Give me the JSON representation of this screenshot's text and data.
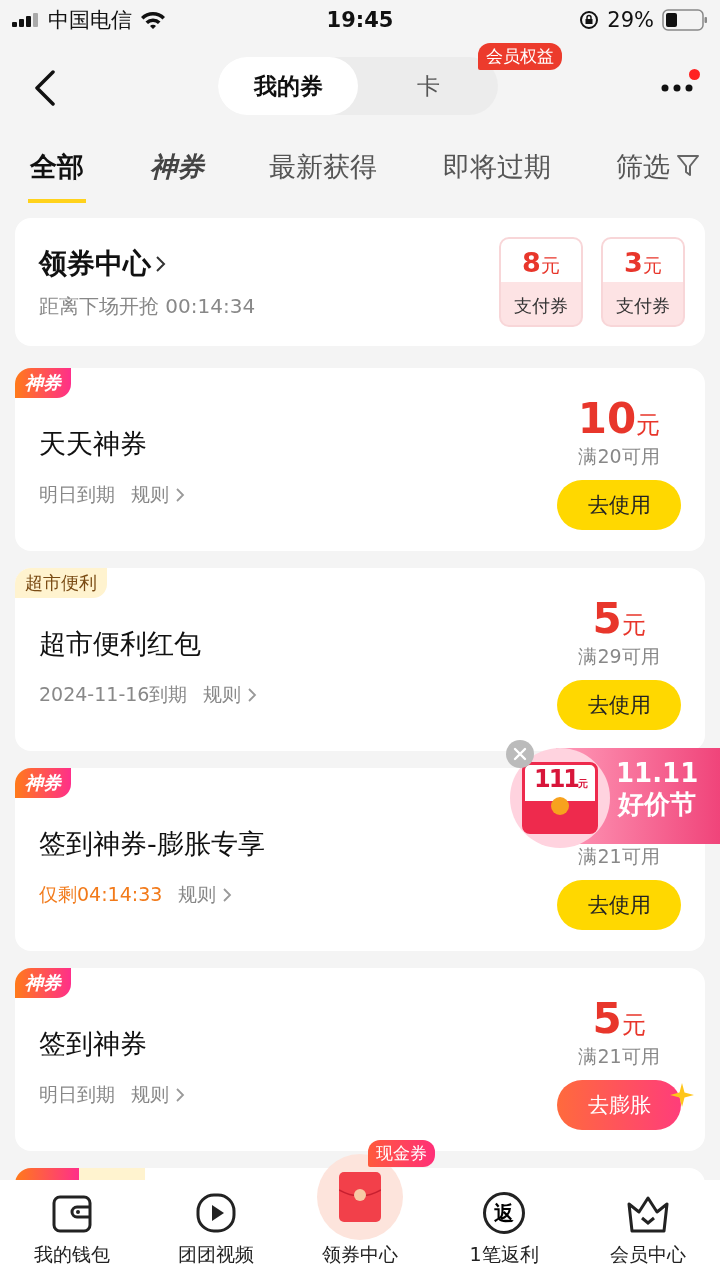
{
  "status_bar": {
    "carrier": "中国电信",
    "time": "19:45",
    "battery": "29%"
  },
  "header": {
    "segments": [
      {
        "label": "我的券",
        "selected": true
      },
      {
        "label": "卡",
        "selected": false
      }
    ],
    "badge": "会员权益",
    "more_dot": true
  },
  "tabs": [
    {
      "label": "全部",
      "selected": true,
      "kind": "text"
    },
    {
      "label": "神券",
      "selected": false,
      "kind": "brand"
    },
    {
      "label": "最新获得",
      "selected": false,
      "kind": "text"
    },
    {
      "label": "即将过期",
      "selected": false,
      "kind": "text"
    }
  ],
  "filter": {
    "label": "筛选"
  },
  "coupon_center": {
    "title": "领券中心",
    "countdown": "距离下场开抢 00:14:34",
    "vouchers": [
      {
        "amount": "8",
        "unit": "元",
        "label": "支付券"
      },
      {
        "amount": "3",
        "unit": "元",
        "label": "支付券"
      }
    ]
  },
  "coupons": [
    {
      "tag": {
        "label": "神券",
        "kind": "brand"
      },
      "name": "天天神券",
      "expiry": "明日到期",
      "expiry_urgent": false,
      "rules": "规则",
      "amount": "10",
      "unit": "元",
      "condition": "满20可用",
      "action": {
        "label": "去使用",
        "kind": "use"
      }
    },
    {
      "tag": {
        "label": "超市便利",
        "kind": "category"
      },
      "name": "超市便利红包",
      "expiry": "2024-11-16到期",
      "expiry_urgent": false,
      "rules": "规则",
      "amount": "5",
      "unit": "元",
      "condition": "满29可用",
      "action": {
        "label": "去使用",
        "kind": "use"
      }
    },
    {
      "tag": {
        "label": "神券",
        "kind": "brand"
      },
      "name": "签到神券-膨胀专享",
      "expiry": "仅剩04:14:33",
      "expiry_urgent": true,
      "rules": "规则",
      "condition": "满21可用",
      "action": {
        "label": "去使用",
        "kind": "use"
      }
    },
    {
      "tag": {
        "label": "神券",
        "kind": "brand"
      },
      "name": "签到神券",
      "expiry": "明日到期",
      "expiry_urgent": false,
      "rules": "规则",
      "amount": "5",
      "unit": "元",
      "condition": "满21可用",
      "action": {
        "label": "去膨胀",
        "kind": "boost"
      }
    }
  ],
  "promo": {
    "amount": "111",
    "unit": "元",
    "line1": "11.11",
    "line2": "好价节"
  },
  "bottom_nav": [
    {
      "label": "我的钱包"
    },
    {
      "label": "团团视频"
    },
    {
      "label": "领券中心",
      "badge": "现金券"
    },
    {
      "label": "1笔返利",
      "glyph": "返"
    },
    {
      "label": "会员中心"
    }
  ]
}
